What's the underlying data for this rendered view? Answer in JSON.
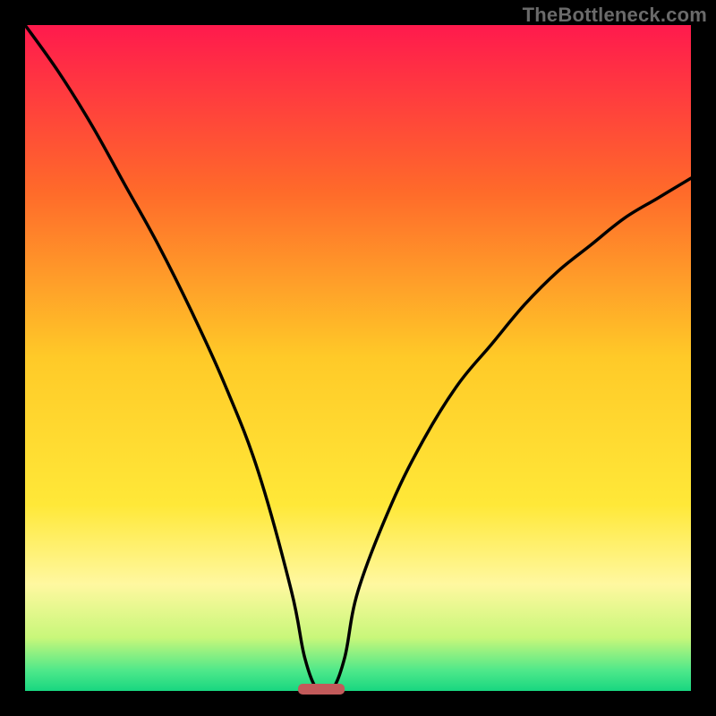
{
  "watermark": "TheBottleneck.com",
  "chart_data": {
    "type": "line",
    "title": "",
    "xlabel": "",
    "ylabel": "",
    "xlim": [
      0,
      100
    ],
    "ylim": [
      0,
      100
    ],
    "x": [
      0,
      5,
      10,
      15,
      20,
      25,
      30,
      35,
      40,
      42,
      44,
      46,
      48,
      50,
      55,
      60,
      65,
      70,
      75,
      80,
      85,
      90,
      95,
      100
    ],
    "series": [
      {
        "name": "bottleneck-curve",
        "values": [
          100,
          93,
          85,
          76,
          67,
          57,
          46,
          33,
          15,
          5,
          0,
          0,
          5,
          15,
          28,
          38,
          46,
          52,
          58,
          63,
          67,
          71,
          74,
          77
        ]
      }
    ],
    "optimal_region": {
      "x_start": 41,
      "x_end": 48,
      "value": 0
    },
    "gradient_stops": [
      {
        "offset": 0.0,
        "color": "#ff1a4d"
      },
      {
        "offset": 0.25,
        "color": "#ff6a2a"
      },
      {
        "offset": 0.5,
        "color": "#ffca28"
      },
      {
        "offset": 0.72,
        "color": "#ffe838"
      },
      {
        "offset": 0.84,
        "color": "#fff8a0"
      },
      {
        "offset": 0.92,
        "color": "#c8f77a"
      },
      {
        "offset": 0.97,
        "color": "#4de88a"
      },
      {
        "offset": 1.0,
        "color": "#18d680"
      }
    ],
    "curve_color": "#000000",
    "marker_color": "#c25a5a"
  }
}
